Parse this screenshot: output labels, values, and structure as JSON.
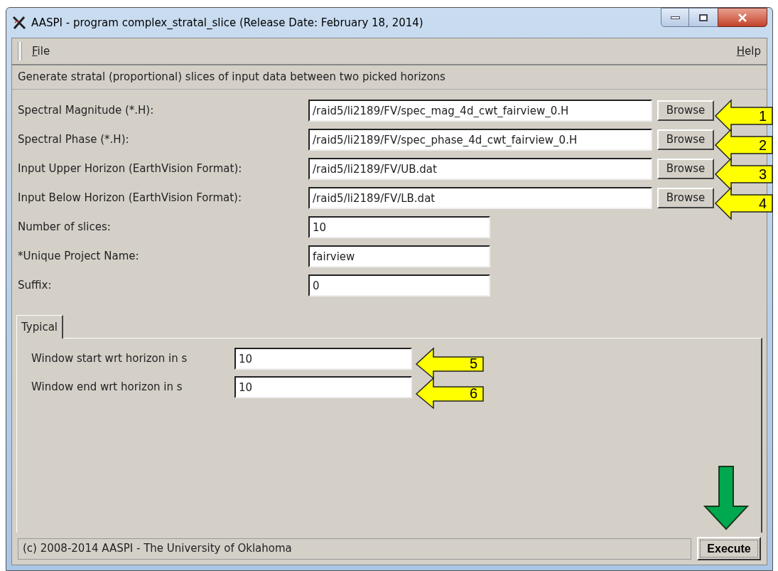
{
  "window": {
    "title": "AASPI - program complex_stratal_slice (Release Date: February 18, 2014)"
  },
  "menu": [
    {
      "label": "File"
    },
    {
      "label": "Help"
    }
  ],
  "description": "Generate stratal (proportional) slices of input data between two picked horizons",
  "fields": [
    {
      "kind": "file",
      "label": "Spectral Magnitude (*.H):",
      "value": "/raid5/li2189/FV/spec_mag_4d_cwt_fairview_0.H",
      "button": "Browse",
      "callout": "1"
    },
    {
      "kind": "file",
      "label": "Spectral Phase (*.H):",
      "value": "/raid5/li2189/FV/spec_phase_4d_cwt_fairview_0.H",
      "button": "Browse",
      "callout": "2"
    },
    {
      "kind": "file",
      "label": "Input Upper Horizon (EarthVision Format):",
      "value": "/raid5/li2189/FV/UB.dat",
      "button": "Browse",
      "callout": "3"
    },
    {
      "kind": "file",
      "label": "Input Below Horizon (EarthVision Format):",
      "value": "/raid5/li2189/FV/LB.dat",
      "button": "Browse",
      "callout": "4"
    },
    {
      "kind": "text",
      "label": "Number of slices:",
      "value": "10"
    },
    {
      "kind": "text",
      "label": "*Unique Project Name:",
      "value": "fairview"
    },
    {
      "kind": "text",
      "label": "Suffix:",
      "value": "0"
    }
  ],
  "tabs": [
    {
      "label": "Typical",
      "selected": true
    }
  ],
  "tab_fields": [
    {
      "label": "Window start wrt horizon in s",
      "value": "10",
      "callout": "5"
    },
    {
      "label": "Window end wrt horizon in s",
      "value": "10",
      "callout": "6"
    }
  ],
  "status_bar": "(c) 2008-2014 AASPI - The University of Oklahoma",
  "execute_button": "Execute"
}
